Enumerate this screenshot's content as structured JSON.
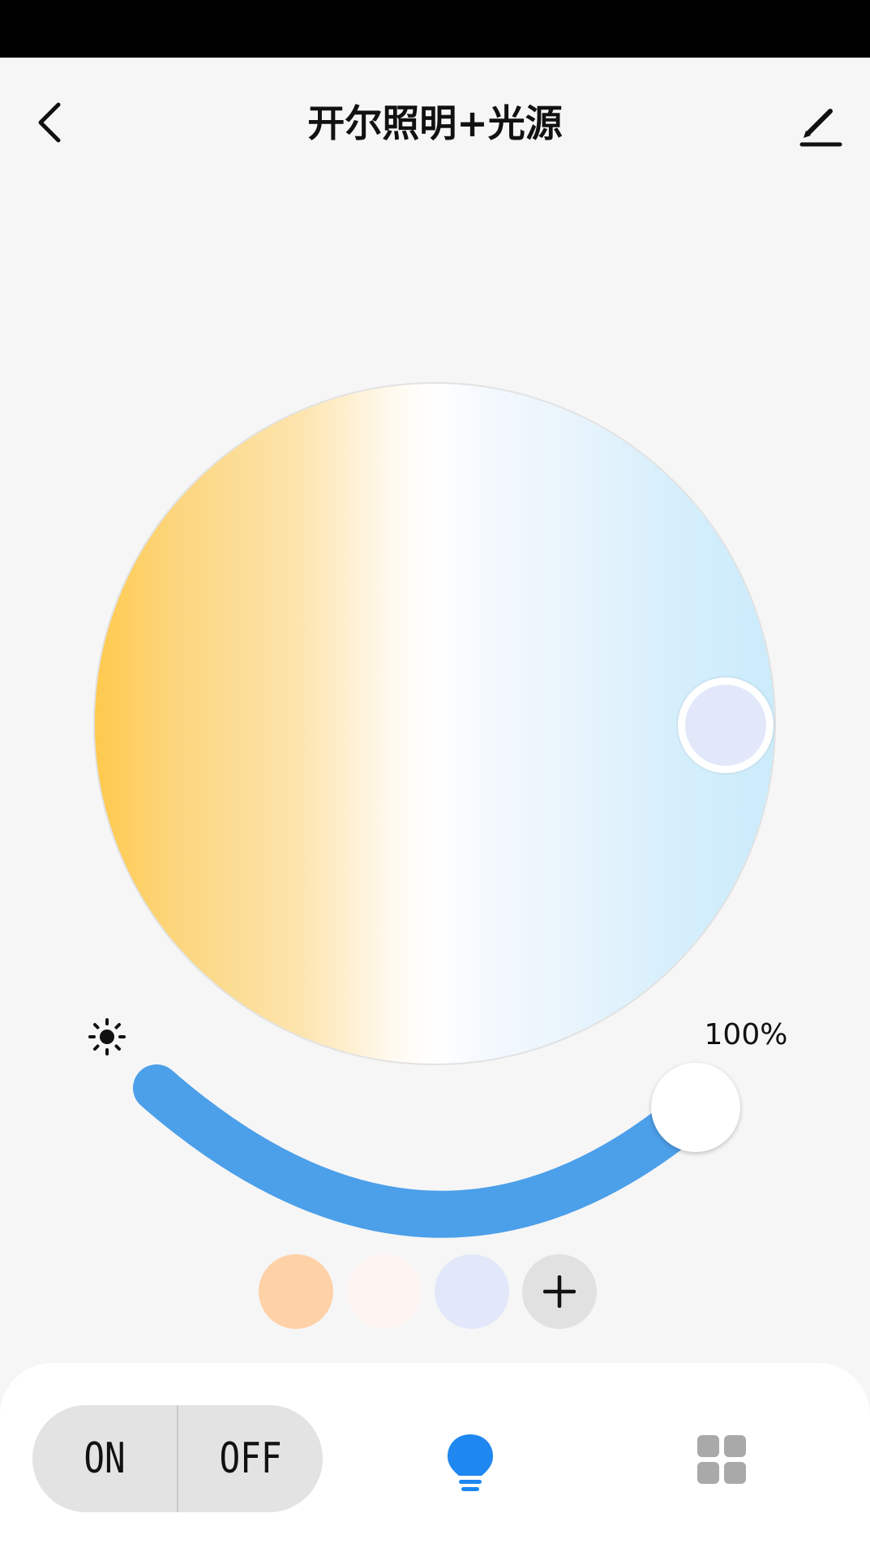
{
  "header": {
    "title": "开尔照明+光源"
  },
  "icons": {
    "back": "chevron-left-icon",
    "edit": "pencil-icon",
    "brightness": "sun-icon",
    "add": "plus-icon",
    "light_tab": "bulb-icon",
    "scenes_tab": "grid-icon"
  },
  "brightness": {
    "value_label": "100%",
    "level": 1.0
  },
  "color_temperature": {
    "selected_color": "#e2e8fa"
  },
  "presets": [
    {
      "color": "#fed1a7"
    },
    {
      "color": "#fdf4f1"
    },
    {
      "color": "#e2e8fa"
    }
  ],
  "power": {
    "on_label": "ON",
    "off_label": "OFF"
  },
  "colors": {
    "accent": "#4c9fe9",
    "active_tab": "#1e87f0",
    "inactive_tab": "#a9a9a9",
    "warm": "#ffc94d",
    "cool": "#cbebfb"
  }
}
